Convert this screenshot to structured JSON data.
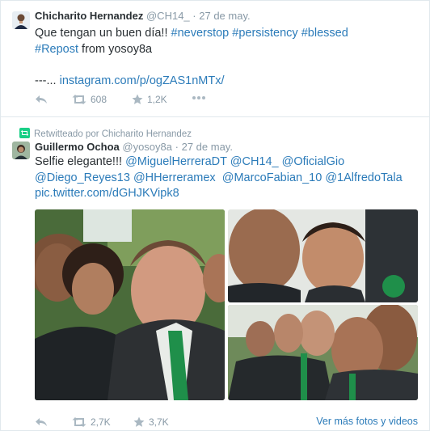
{
  "tweet1": {
    "name": "Chicharito Hernandez",
    "handle": "@CH14_",
    "dot": "·",
    "time": "27 de may.",
    "text_line1_plain": "Que tengan un buen día!! ",
    "hashtag_neverstop": "#neverstop",
    "hashtag_persistency": "#persistency",
    "hashtag_blessed": "#blessed",
    "hashtag_repost": "#Repost",
    "from_text": " from yosoy8a",
    "dashes": "---... ",
    "instagram_link": "instagram.com/p/ogZAS1nMTx/",
    "retweets": "608",
    "favorites": "1,2K"
  },
  "tweet2": {
    "retweet_note": "Retwitteado por Chicharito Hernandez",
    "name": "Guillermo Ochoa",
    "handle": "@yosoy8a",
    "dot": "·",
    "time": "27 de may.",
    "text_plain": "Selfie elegante!!! ",
    "mention_herrera": "@MiguelHerreraDT",
    "mention_ch14": "@CH14_",
    "mention_gio": "@OficialGio",
    "mention_reyes": "@Diego_Reyes13",
    "mention_hh": "@HHerreramex",
    "mention_fabian": "@MarcoFabian_10",
    "mention_tala": "@1AlfredoTala",
    "pic_link": "pic.twitter.com/dGHJKVipk8",
    "retweets": "2,7K",
    "favorites": "3,7K",
    "more_photos": "Ver más fotos y videos"
  },
  "colors": {
    "link": "#2b7bb9",
    "meta": "#8899a6",
    "text": "#292f33",
    "retweet_green": "#19cf86",
    "divider": "#e1e8ed"
  },
  "icons": [
    "reply-icon",
    "retweet-icon",
    "favorite-star-icon",
    "more-dots-icon",
    "retweeted-by-icon"
  ]
}
